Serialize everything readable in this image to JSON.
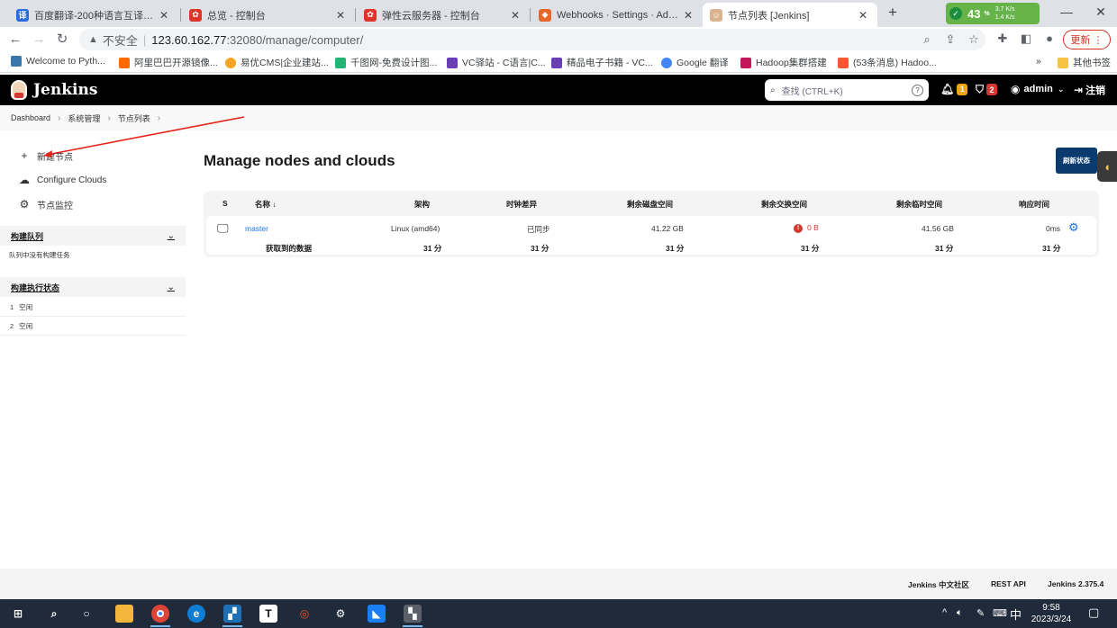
{
  "browser": {
    "tabs": [
      {
        "title": "百度翻译-200种语言互译、沟通",
        "icon": "baidu-translate-icon",
        "color": "#2a6ce0",
        "glyph": "译"
      },
      {
        "title": "总览 - 控制台",
        "icon": "huawei-cloud-icon",
        "color": "#e0332a",
        "glyph": ""
      },
      {
        "title": "弹性云服务器 - 控制台",
        "icon": "huawei-cloud-icon",
        "color": "#e0332a",
        "glyph": ""
      },
      {
        "title": "Webhooks · Settings · Administ",
        "icon": "gitlab-icon",
        "color": "#e8682a",
        "glyph": ""
      },
      {
        "title": "节点列表 [Jenkins]",
        "icon": "jenkins-icon",
        "color": "#d9b48f",
        "glyph": ""
      }
    ],
    "extension": {
      "percent": "43",
      "unit": "%",
      "up": "3.7 K/s",
      "down": "1.4 K/s"
    },
    "address": {
      "security": "不安全",
      "host": "123.60.162.77",
      "path": ":32080/manage/computer/"
    },
    "update_label": "更新",
    "bookmarks": [
      {
        "label": "Welcome to Pyth...",
        "color": "#3776ab"
      },
      {
        "label": "阿里巴巴开源镜像...",
        "color": "#ff6a00"
      },
      {
        "label": "易优CMS|企业建站...",
        "color": "#f5a623"
      },
      {
        "label": "千图网-免费设计图...",
        "color": "#22b573"
      },
      {
        "label": "VC驿站 - C语言|C...",
        "color": "#6a3fb5"
      },
      {
        "label": "精品电子书籍 - VC...",
        "color": "#6a3fb5"
      },
      {
        "label": "Google 翻译",
        "color": "#4285f4"
      },
      {
        "label": "Hadoop集群搭建",
        "color": "#c2185b"
      },
      {
        "label": "(53条消息) Hadoo...",
        "color": "#fc5531"
      }
    ],
    "bookmarks_more": "»",
    "other_bookmarks": "其他书签"
  },
  "jenkins": {
    "brand": "Jenkins",
    "search_placeholder": "查找 (CTRL+K)",
    "notifications_count": "1",
    "security_count": "2",
    "user": "admin",
    "logout": "注销"
  },
  "breadcrumb": [
    "Dashboard",
    "系统管理",
    "节点列表"
  ],
  "side_tasks": [
    {
      "label": "新建节点",
      "icon": "plus-icon"
    },
    {
      "label": "Configure Clouds",
      "icon": "cloud-icon"
    },
    {
      "label": "节点监控",
      "icon": "gear-icon"
    }
  ],
  "build_queue": {
    "title": "构建队列",
    "empty": "队列中没有构建任务"
  },
  "executors": {
    "title": "构建执行状态",
    "rows": [
      {
        "num": "1",
        "status": "空闲"
      },
      {
        "num": "2",
        "status": "空闲"
      }
    ]
  },
  "page_title": "Manage nodes and clouds",
  "refresh_label": "刷新状态",
  "table": {
    "headers": [
      "S",
      "名称 ↓",
      "架构",
      "时钟差异",
      "剩余磁盘空间",
      "剩余交换空间",
      "剩余临时空间",
      "响应时间"
    ],
    "node": {
      "name": "master",
      "arch": "Linux (amd64)",
      "clock": "已同步",
      "disk": "41.22 GB",
      "swap": "0 B",
      "temp": "41.56 GB",
      "response": "0ms"
    },
    "summary": {
      "label": "获取到的数据",
      "arch": "31 分",
      "clock": "31 分",
      "disk": "31 分",
      "swap": "31 分",
      "temp": "31 分",
      "response": "31 分"
    }
  },
  "footer": {
    "community": "Jenkins 中文社区",
    "rest_api": "REST API",
    "version": "Jenkins 2.375.4"
  },
  "taskbar": {
    "ime": "中",
    "time": "9:58",
    "date": "2023/3/24"
  }
}
